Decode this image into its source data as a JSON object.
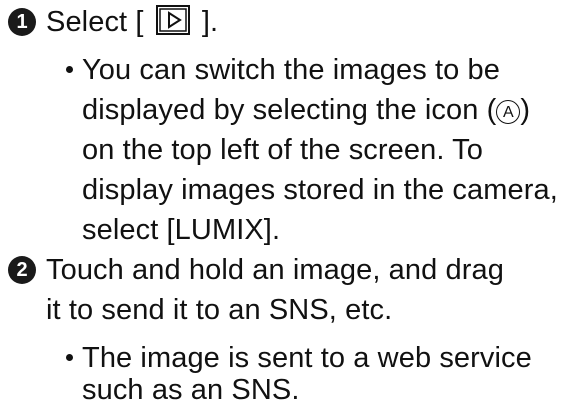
{
  "steps": [
    {
      "number": "1",
      "line1_before_icon": "Select [",
      "line1_after_icon": "].",
      "icon": "playback-icon",
      "bullet": {
        "line1": "You can switch the images to be",
        "line2_a": "displayed by selecting the icon (",
        "circle_label": "A",
        "line2_b": ")",
        "line3": "on the top left of the screen. To",
        "line4": "display images stored in the camera,",
        "line5": "select [LUMIX]."
      }
    },
    {
      "number": "2",
      "line1": "Touch and hold an image, and drag",
      "line2": "it to send it to an SNS, etc.",
      "bullet": {
        "line1": "The image is sent to a web service",
        "line2": "such as an SNS."
      }
    }
  ]
}
